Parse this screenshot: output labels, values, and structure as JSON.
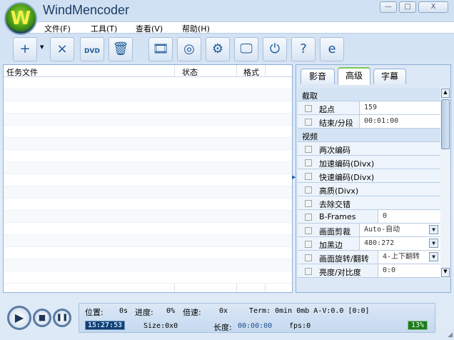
{
  "app": {
    "title": "WindMencoder",
    "logo_letter": "W"
  },
  "window_controls": {
    "minimize": "—",
    "maximize": "□",
    "close": "X"
  },
  "menu": [
    "文件(F)",
    "工具(T)",
    "查看(V)",
    "帮助(H)"
  ],
  "toolbar": [
    {
      "name": "add-file",
      "icon": "folder-add-icon",
      "glyph": "+"
    },
    {
      "name": "remove-file",
      "icon": "folder-remove-icon",
      "glyph": "×"
    },
    {
      "name": "add-dvd",
      "icon": "folder-dvd-icon",
      "glyph": "DVD"
    },
    {
      "name": "clear",
      "icon": "recycle-bin-icon",
      "glyph": "🗑"
    },
    {
      "name": "convert",
      "icon": "film-document-icon",
      "glyph": "🎞"
    },
    {
      "name": "disc",
      "icon": "disc-icon",
      "glyph": "◎"
    },
    {
      "name": "settings",
      "icon": "gear-tools-icon",
      "glyph": "⚙"
    },
    {
      "name": "preview",
      "icon": "monitor-icon",
      "glyph": "🖵"
    },
    {
      "name": "power",
      "icon": "power-icon",
      "glyph": "⏻"
    },
    {
      "name": "help",
      "icon": "help-icon",
      "glyph": "?"
    },
    {
      "name": "browser",
      "icon": "internet-explorer-icon",
      "glyph": "e"
    }
  ],
  "task_list": {
    "columns": [
      "任务文件",
      "状态",
      "格式"
    ],
    "rows": []
  },
  "panel": {
    "tabs": [
      "影音",
      "高级",
      "字幕"
    ],
    "active_tab": "高级",
    "rows": [
      {
        "type": "category",
        "label": "截取"
      },
      {
        "label": "起点",
        "value": "159"
      },
      {
        "label": "结束/分段",
        "value": "00:01:00"
      },
      {
        "type": "category",
        "label": "视频"
      },
      {
        "label": "两次编码"
      },
      {
        "label": "加速编码(Divx)"
      },
      {
        "label": "快速编码(Divx)"
      },
      {
        "label": "高质(Divx)"
      },
      {
        "label": "去除交错"
      },
      {
        "label": "B-Frames",
        "value": "0"
      },
      {
        "label": "画面剪裁",
        "value": "Auto-自动",
        "dropdown": true
      },
      {
        "label": "加黑边",
        "value": "480:272",
        "dropdown": true
      },
      {
        "label": "画面旋转/翻转",
        "value": "4-上下翻转",
        "dropdown": true
      },
      {
        "label": "亮度/对比度",
        "value": "0:0"
      }
    ]
  },
  "status": {
    "position_label": "位置:",
    "position": "0s",
    "progress_label": "进度:",
    "progress": "0%",
    "speed_label": "倍速:",
    "speed": "0x",
    "term": "Term: 0min 0mb A-V:0.0 [0:0]",
    "clock": "15:27:53",
    "size": "Size:0x0",
    "length_label": "长度:",
    "length": "00:00:00",
    "fps": "fps:0",
    "cpu": "13%"
  },
  "colors": {
    "accent": "#1e3d63",
    "cpu": "#1f7a1f"
  }
}
